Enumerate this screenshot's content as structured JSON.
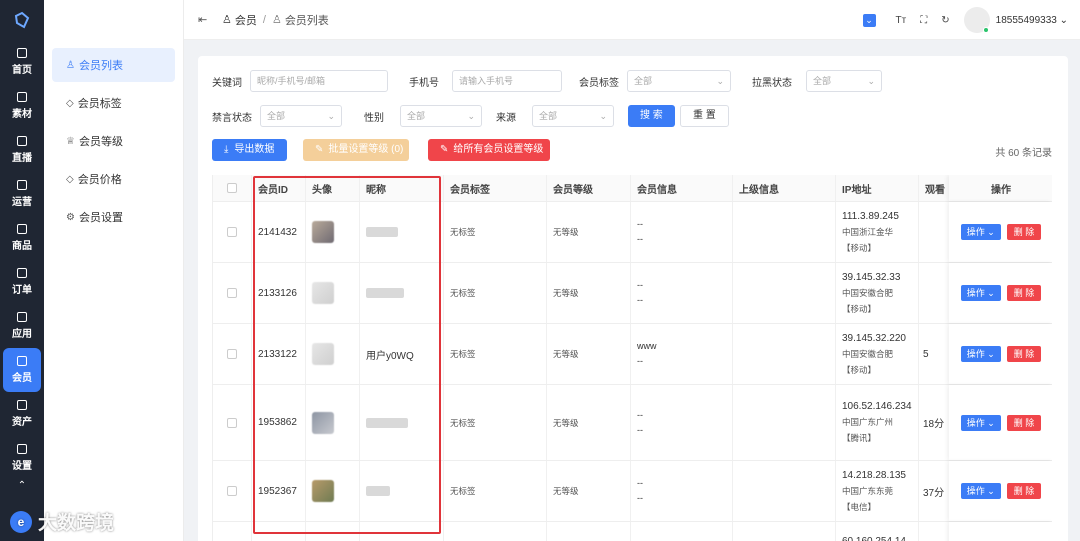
{
  "rail": {
    "items": [
      {
        "label": "首页",
        "icon": "home-icon"
      },
      {
        "label": "素材",
        "icon": "image-icon"
      },
      {
        "label": "直播",
        "icon": "video-icon"
      },
      {
        "label": "运营",
        "icon": "operations-icon"
      },
      {
        "label": "商品",
        "icon": "cart-icon"
      },
      {
        "label": "订单",
        "icon": "order-icon"
      },
      {
        "label": "应用",
        "icon": "drop-icon"
      },
      {
        "label": "会员",
        "icon": "user-icon"
      },
      {
        "label": "资产",
        "icon": "wallet-icon"
      },
      {
        "label": "设置",
        "icon": "settings-icon"
      }
    ],
    "active": "会员"
  },
  "submenu": {
    "items": [
      "会员列表",
      "会员标签",
      "会员等级",
      "会员价格",
      "会员设置"
    ],
    "active": "会员列表"
  },
  "header": {
    "breadcrumb": [
      "会员",
      "会员列表"
    ],
    "user": "18555499333"
  },
  "filters": {
    "keyword_label": "关键词",
    "keyword_placeholder": "昵称/手机号/邮箱",
    "phone_label": "手机号",
    "phone_placeholder": "请输入手机号",
    "tag_label": "会员标签",
    "tag_value": "全部",
    "blacklist_label": "拉黑状态",
    "blacklist_value": "全部",
    "mute_label": "禁言状态",
    "mute_value": "全部",
    "gender_label": "性别",
    "gender_value": "全部",
    "source_label": "来源",
    "source_value": "全部",
    "search_btn": "搜 索",
    "reset_btn": "重 置"
  },
  "actions": {
    "export": "导出数据",
    "batch_level": "批量设置等级 (0)",
    "all_level": "给所有会员设置等级",
    "total": "共 60 条记录"
  },
  "table": {
    "headers": [
      "会员ID",
      "头像",
      "昵称",
      "会员标签",
      "会员等级",
      "会员信息",
      "上级信息",
      "IP地址",
      "观看",
      "操作"
    ],
    "rows": [
      {
        "id": "2141432",
        "nickname": "",
        "tag": "无标签",
        "level": "无等级",
        "info": [
          "--",
          "--"
        ],
        "ip": "111.3.89.245",
        "region": "中国浙江金华",
        "isp": "【移动】",
        "watch": ""
      },
      {
        "id": "2133126",
        "nickname": "",
        "tag": "无标签",
        "level": "无等级",
        "info": [
          "--",
          "--"
        ],
        "ip": "39.145.32.33",
        "region": "中国安徽合肥",
        "isp": "【移动】",
        "watch": ""
      },
      {
        "id": "2133122",
        "nickname": "用户y0WQ",
        "tag": "无标签",
        "level": "无等级",
        "info": [
          "www",
          "--"
        ],
        "ip": "39.145.32.220",
        "region": "中国安徽合肥",
        "isp": "【移动】",
        "watch": "5"
      },
      {
        "id": "1953862",
        "nickname": "",
        "tag": "无标签",
        "level": "无等级",
        "info": [
          "--",
          "--"
        ],
        "ip": "106.52.146.234",
        "region": "中国广东广州",
        "isp": "【腾讯】",
        "watch": "18分"
      },
      {
        "id": "1952367",
        "nickname": "",
        "tag": "无标签",
        "level": "无等级",
        "info": [
          "--",
          "--"
        ],
        "ip": "14.218.28.135",
        "region": "中国广东东莞",
        "isp": "【电信】",
        "watch": "37分"
      },
      {
        "id": "",
        "nickname": "",
        "tag": "",
        "level": "",
        "info": [
          "",
          ""
        ],
        "ip": "60.160.254.14",
        "region": "",
        "isp": "",
        "watch": ""
      }
    ],
    "op_label": "操作",
    "del_label": "删 除"
  },
  "watermark": "大数跨境"
}
